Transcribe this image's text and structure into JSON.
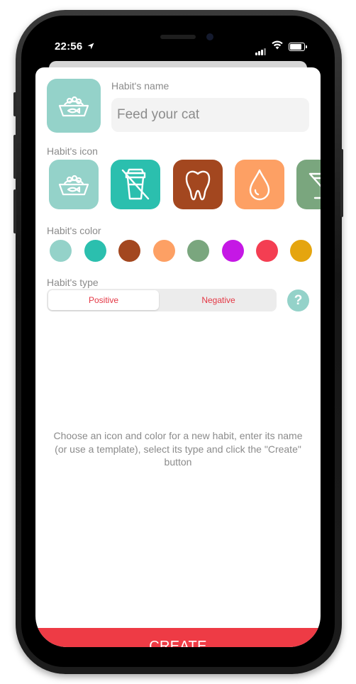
{
  "status_bar": {
    "time": "22:56",
    "location_icon": "location-arrow-icon",
    "battery_level": 0.95
  },
  "form": {
    "name_label": "Habit's name",
    "name_placeholder": "Feed your cat",
    "icon_label": "Habit's icon",
    "color_label": "Habit's color",
    "type_label": "Habit's type"
  },
  "selected": {
    "icon": "cat-food-bowl-icon",
    "color": "#94d2c9"
  },
  "icons": [
    {
      "name": "cat-food-bowl-icon",
      "color": "#94d2c9"
    },
    {
      "name": "no-drink-cup-icon",
      "color": "#2bbfae"
    },
    {
      "name": "tooth-icon",
      "color": "#a3471f"
    },
    {
      "name": "water-drop-icon",
      "color": "#fda064"
    },
    {
      "name": "cocktail-glass-icon",
      "color": "#7aa67e"
    }
  ],
  "colors": [
    "#94d2c9",
    "#2bbfae",
    "#a3471f",
    "#fda064",
    "#7aa67e",
    "#c518e5",
    "#f43e52",
    "#e5a50f"
  ],
  "type_options": {
    "positive": "Positive",
    "negative": "Negative",
    "selected": "positive"
  },
  "help_label": "?",
  "hint": "Choose an icon and color for a new habit, enter its name (or use a template), select its type and click the \"Create\" button",
  "create_label": "CREATE"
}
